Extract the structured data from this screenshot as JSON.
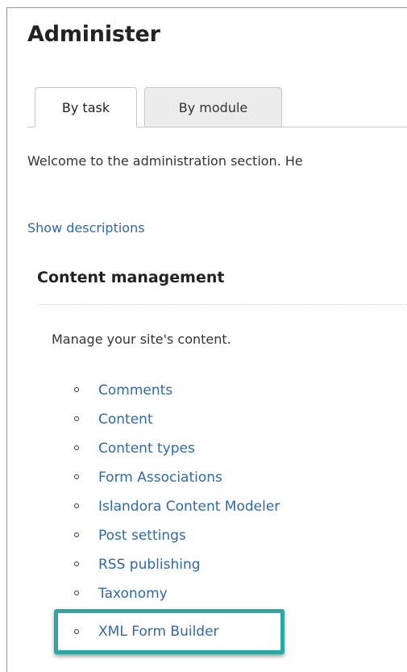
{
  "header": {
    "title": "Administer"
  },
  "tabs": [
    {
      "label": "By task",
      "active": true
    },
    {
      "label": "By module",
      "active": false
    }
  ],
  "intro": {
    "welcome_text": "Welcome to the administration section. He",
    "show_descriptions_link": "Show descriptions"
  },
  "section": {
    "title": "Content management",
    "description": "Manage your site's content.",
    "items": [
      {
        "label": "Comments"
      },
      {
        "label": "Content"
      },
      {
        "label": "Content types"
      },
      {
        "label": "Form Associations"
      },
      {
        "label": "Islandora Content Modeler"
      },
      {
        "label": "Post settings"
      },
      {
        "label": "RSS publishing"
      },
      {
        "label": "Taxonomy"
      }
    ],
    "highlighted_item": {
      "label": "XML Form Builder"
    }
  },
  "colors": {
    "link": "#2f6aa7",
    "highlight": "#2aa8a1",
    "text": "#222222"
  }
}
